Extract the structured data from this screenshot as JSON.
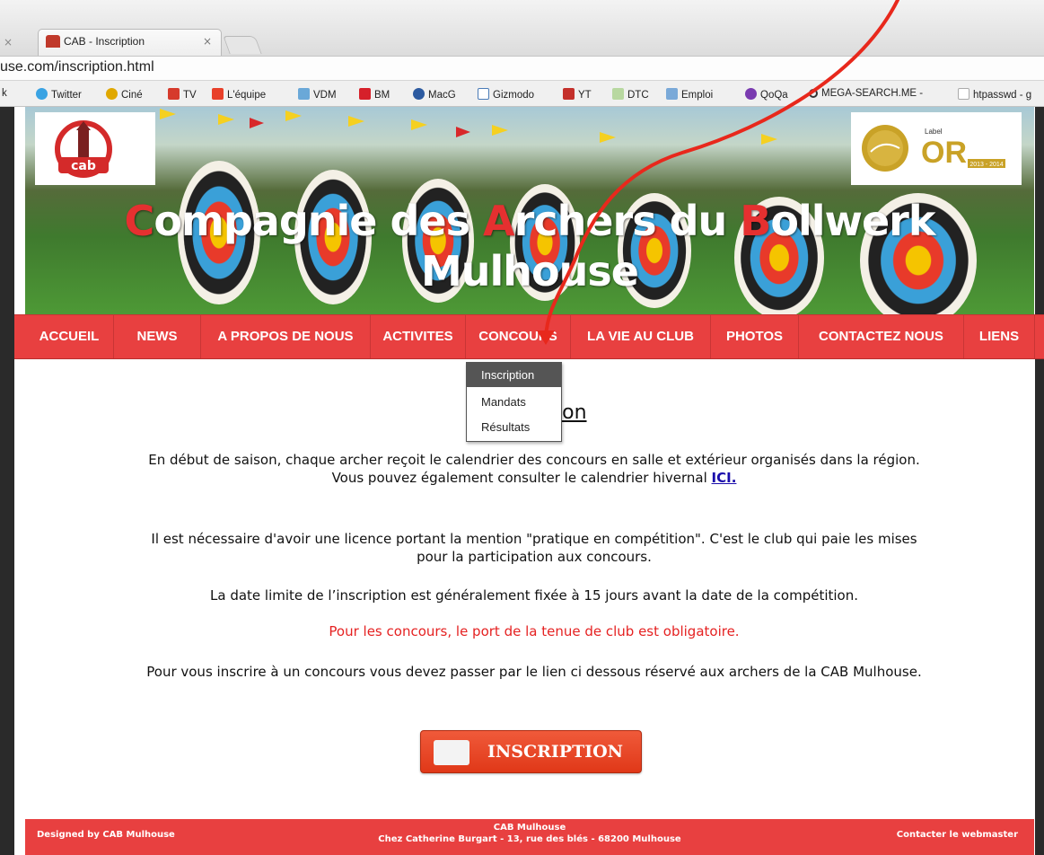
{
  "browser": {
    "tab_title": "CAB - Inscription",
    "url": "use.com/inscription.html",
    "bookmarks": [
      "k",
      "Twitter",
      "Ciné",
      "TV",
      "L'équipe",
      "VDM",
      "BM",
      "MacG",
      "Gizmodo",
      "YT",
      "DTC",
      "Emploi",
      "QoQa",
      "MEGA-SEARCH.ME -",
      "htpasswd - g"
    ]
  },
  "header": {
    "title_line1": [
      "C",
      "ompagnie des ",
      "A",
      "rchers du ",
      "B",
      "ollwerk"
    ],
    "title_line2": "Mulhouse",
    "label_badge": "Label",
    "label_or": "OR",
    "label_years": "2013 - 2014"
  },
  "nav": {
    "items": [
      "ACCUEIL",
      "NEWS",
      "A PROPOS DE NOUS",
      "ACTIVITES",
      "CONCOURS",
      "LA VIE AU CLUB",
      "PHOTOS",
      "CONTACTEZ NOUS",
      "LIENS"
    ]
  },
  "dropdown": {
    "items": [
      "Inscription",
      "Mandats",
      "Résultats"
    ],
    "active": "Inscription"
  },
  "content": {
    "heading_visible": "ion",
    "p1": "En début de saison, chaque archer reçoit le calendrier des concours en salle et extérieur organisés dans la région.",
    "p1b": "Vous pouvez également consulter le calendrier hivernal",
    "p1_link": "ICI.",
    "p2": "Il est nécessaire d'avoir une licence portant la mention \"pratique en compétition\". C'est le club qui paie les mises pour la participation aux concours.",
    "p3": "La date limite de l’inscription est généralement fixée à 15 jours avant la date de la compétition.",
    "p4": "Pour les concours, le port de la tenue de club est obligatoire.",
    "p5": "Pour vous inscrire à un concours vous devez passer par le lien ci dessous réservé aux archers de la CAB Mulhouse.",
    "button": "INSCRIPTION"
  },
  "footer": {
    "left": "Designed by CAB Mulhouse",
    "center_line1": "CAB Mulhouse",
    "center_line2": "Chez Catherine Burgart - 13, rue des blés - 68200 Mulhouse",
    "right": "Contacter le webmaster"
  },
  "colors": {
    "nav_red": "#e84040",
    "title_red_letters": "#e53030",
    "notice_red": "#e52222"
  }
}
